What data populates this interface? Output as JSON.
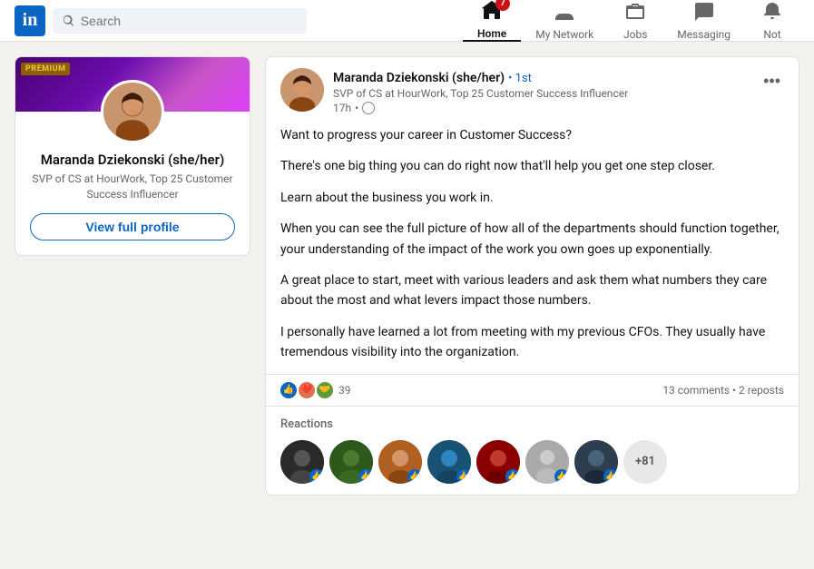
{
  "navbar": {
    "logo_text": "in",
    "search_placeholder": "Search",
    "nav_items": [
      {
        "id": "home",
        "label": "Home",
        "active": true,
        "badge": "7"
      },
      {
        "id": "my-network",
        "label": "My Network",
        "active": false,
        "badge": null
      },
      {
        "id": "jobs",
        "label": "Jobs",
        "active": false,
        "badge": null
      },
      {
        "id": "messaging",
        "label": "Messaging",
        "active": false,
        "badge": null
      },
      {
        "id": "notifications",
        "label": "Not",
        "active": false,
        "badge": null
      }
    ]
  },
  "sidebar": {
    "premium_badge": "PREMIUM",
    "profile": {
      "name": "Maranda Dziekonski (she/her)",
      "title": "SVP of CS at HourWork, Top 25 Customer Success Influencer",
      "view_profile_label": "View full profile"
    }
  },
  "post": {
    "author_name": "Maranda Dziekonski (she/her)",
    "author_badge": "• 1st",
    "author_title": "SVP of CS at HourWork, Top 25 Customer Success Influencer",
    "time": "17h",
    "paragraphs": [
      "Want to progress your career in Customer Success?",
      "There's one big thing you can do right now that'll help you get one step closer.",
      "Learn about the business you work in.",
      "When you can see the full picture of how all of the departments should function together, your understanding of the impact of the work you own goes up exponentially.",
      "A great place to start, meet with various leaders and ask them what numbers they care about the most and what levers impact those numbers.",
      "I personally have learned a lot from meeting with my previous CFOs. They usually have tremendous visibility into the organization."
    ],
    "stats": {
      "reactions_count": "39",
      "comments_reposts": "13 comments • 2 reposts"
    },
    "reactions_section": {
      "title": "Reactions",
      "plus_count": "+81"
    }
  },
  "avatar_colors": [
    "#3a3a3a",
    "#2d5a1b",
    "#b06020",
    "#1a5276",
    "#8b0000",
    "#555555",
    "#2c3e50"
  ],
  "colors": {
    "brand": "#0a66c2",
    "premium": "#8b5e00",
    "like": "#0a66c2"
  }
}
